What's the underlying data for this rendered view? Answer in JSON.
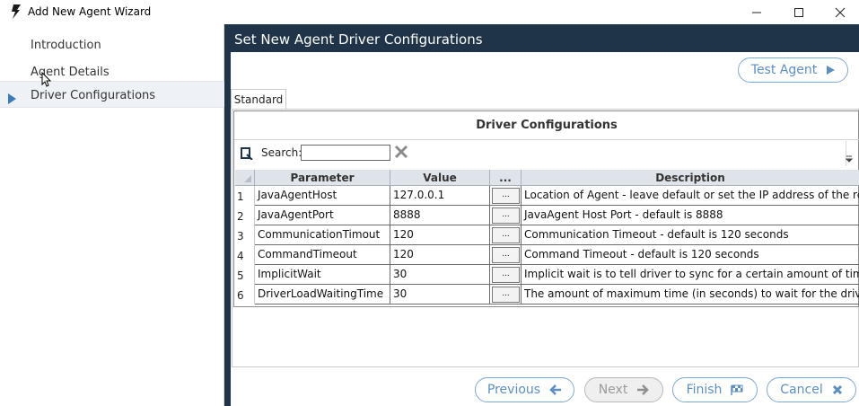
{
  "window": {
    "title": "Add New Agent Wizard",
    "controls": {
      "minimize": "—",
      "maximize": "☐",
      "close": "✕"
    }
  },
  "sidebar": {
    "items": [
      {
        "label": "Introduction",
        "active": false
      },
      {
        "label": "Agent Details",
        "active": false
      },
      {
        "label": "Driver Configurations",
        "active": true
      }
    ]
  },
  "main": {
    "header": "Set New Agent Driver Configurations",
    "test_agent_label": "Test Agent",
    "tab_label": "Standard"
  },
  "grid": {
    "title": "Driver Configurations",
    "search_label": "Search:",
    "search_value": "",
    "columns": [
      "Parameter",
      "Value",
      "...",
      "Description"
    ],
    "rows": [
      {
        "num": "1",
        "parameter": "JavaAgentHost",
        "value": "127.0.0.1",
        "dots": "...",
        "description": "Location of Agent - leave default or set the IP address of the remote n"
      },
      {
        "num": "2",
        "parameter": "JavaAgentPort",
        "value": "8888",
        "dots": "...",
        "description": "JavaAgent Host Port - default is 8888"
      },
      {
        "num": "3",
        "parameter": "CommunicationTimout",
        "value": "120",
        "dots": "...",
        "description": "Communication Timeout - default is 120 seconds"
      },
      {
        "num": "4",
        "parameter": "CommandTimeout",
        "value": "120",
        "dots": "...",
        "description": "Command Timeout - default is 120 seconds"
      },
      {
        "num": "5",
        "parameter": "ImplicitWait",
        "value": "30",
        "dots": "...",
        "description": "Implicit wait is to tell driver to sync for a certain amount of time when"
      },
      {
        "num": "6",
        "parameter": "DriverLoadWaitingTime",
        "value": "30",
        "dots": "...",
        "description": "The amount of maximum time (in seconds) to wait for the driver to loa"
      }
    ]
  },
  "footer": {
    "previous_label": "Previous",
    "next_label": "Next",
    "finish_label": "Finish",
    "cancel_label": "Cancel",
    "next_enabled": false
  },
  "colors": {
    "accent": "#5b8fc4",
    "header_bg": "#1f3349",
    "active_arrow": "#3a7cc1"
  }
}
